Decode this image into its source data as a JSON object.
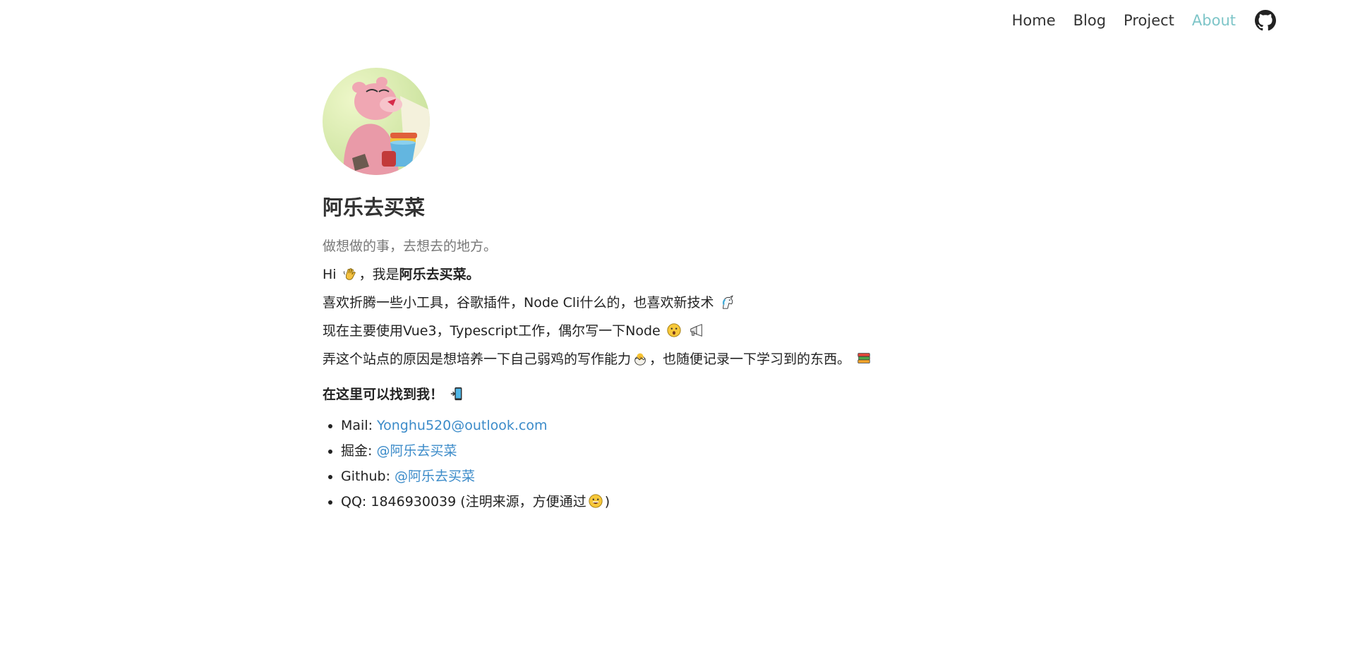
{
  "nav": {
    "items": [
      {
        "label": "Home"
      },
      {
        "label": "Blog"
      },
      {
        "label": "Project"
      },
      {
        "label": "About"
      }
    ],
    "active_color": "#7ec5c8",
    "github_icon": "github-icon"
  },
  "profile": {
    "name": "阿乐去买菜",
    "motto": "做想做的事，去想去的地方。"
  },
  "intro": {
    "hi": "Hi",
    "hi_mid": "，我是",
    "hi_name": "阿乐去买菜。",
    "line2": "喜欢折腾一些小工具，谷歌插件，Node Cli什么的，也喜欢新技术",
    "line3": "现在主要使用Vue3，Typescript工作，偶尔写一下Node",
    "line4_a": "弄这个站点的原因是想培养一下自己弱鸡的写作能力",
    "line4_b": "，也随便记录一下学习到的东西。"
  },
  "contact": {
    "heading": "在这里可以找到我！",
    "items": [
      {
        "label": "Mail: ",
        "value": "Yonghu520@outlook.com"
      },
      {
        "label": "掘金: ",
        "value": "@阿乐去买菜"
      },
      {
        "label": "Github: ",
        "value": "@阿乐去买菜"
      },
      {
        "label": "QQ: 1846930039 (注明来源，方便通过",
        "suffix": ")"
      }
    ]
  },
  "colors": {
    "link": "#3b8bc9",
    "muted": "#777777"
  }
}
